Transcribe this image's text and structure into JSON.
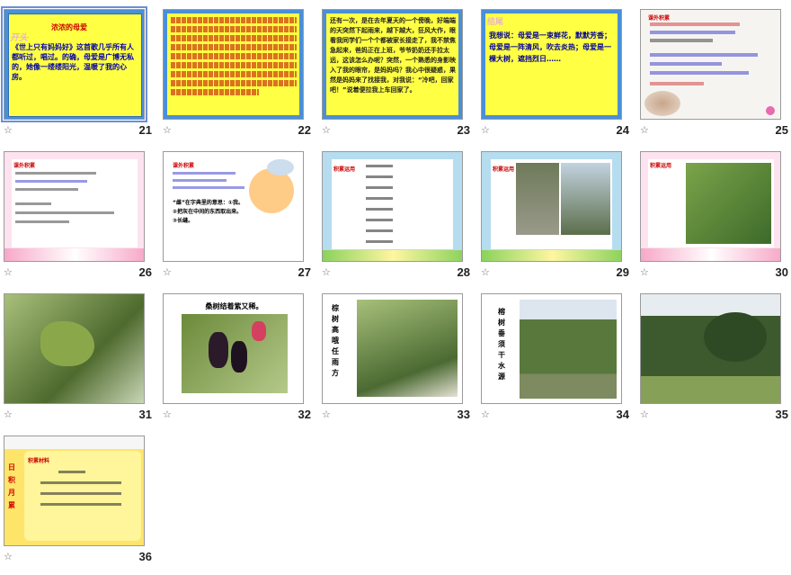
{
  "slides": [
    {
      "num": "21",
      "title": "浓浓的母爱",
      "side": "开头",
      "body": "《世上只有妈妈好》这首歌几乎所有人都听过，唱过。的确，母爱是广博无私的，她像一缕缕阳光，温暖了我的心房。"
    },
    {
      "num": "22"
    },
    {
      "num": "23",
      "body": "还有一次，是在去年夏天的一个傍晚，好端端的天突然下起雨来，越下越大，狂风大作，眼看我同学们一个个都被家长接走了，我不禁焦急起来，爸妈正在上班，爷爷奶奶还手拉太远，这该怎么办呢？突然，一个熟悉的身影映入了我的眼帘，是妈妈吗？我心中很疑惑，果然是妈妈来了找接我，对我说：“冷吧，回家吧！”说着便拉我上车回家了。"
    },
    {
      "num": "24",
      "side": "结尾",
      "body": "我想说：母爱是一束鲜花，默默芳香；母爱是一阵清风，吹去炎热；母爱是一棵大树，遮挡烈日……"
    },
    {
      "num": "25",
      "label": "课外积累"
    },
    {
      "num": "26",
      "label": "课外积累"
    },
    {
      "num": "27",
      "label": "课外积累",
      "body": "“雌”在字典里的意思：①我。②把灰在中间的东西取出来。③长缝。"
    },
    {
      "num": "28",
      "label": "积累运用"
    },
    {
      "num": "29",
      "label": "积累运用"
    },
    {
      "num": "30",
      "label": "积累运用"
    },
    {
      "num": "31"
    },
    {
      "num": "32",
      "caption": "桑树结着紫又稀。"
    },
    {
      "num": "33",
      "vertical": "棕树高哦任雨方"
    },
    {
      "num": "34",
      "vertical": "榕树垂须干水源"
    },
    {
      "num": "35"
    },
    {
      "num": "36",
      "label": "积累材料",
      "side": "日积月累"
    }
  ],
  "star_icon": "☆"
}
